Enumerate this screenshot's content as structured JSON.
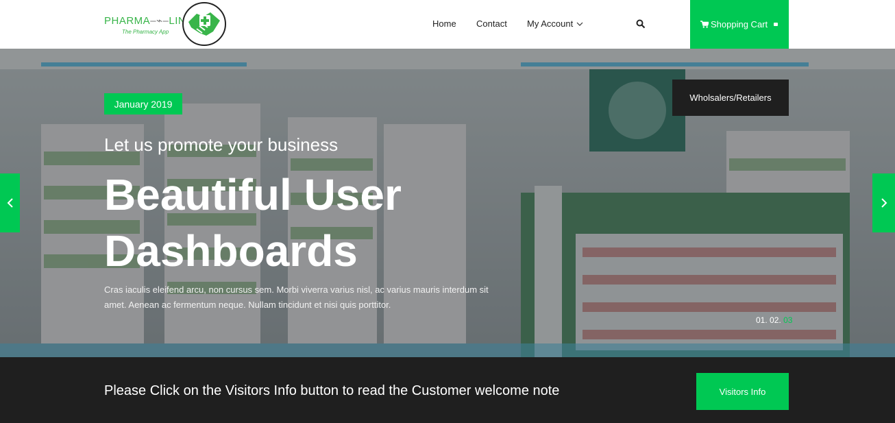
{
  "brand": {
    "name_left": "PHARMA",
    "name_right": "LINK",
    "tagline": "The Pharmacy App",
    "accent_color": "#00c853"
  },
  "nav": {
    "items": [
      {
        "label": "Home"
      },
      {
        "label": "Contact"
      },
      {
        "label": "My Account"
      }
    ],
    "search_icon": "search-icon",
    "cart_label": "Shopping Cart",
    "cart_icon": "shopping-cart-icon"
  },
  "hero": {
    "date_badge": "January 2019",
    "subtitle": "Let us promote your business",
    "title": "Beautiful User Dashboards",
    "text": "Cras iaculis eleifend arcu, non cursus sem. Morbi viverra varius nisl, ac varius mauris interdum sit amet. Aenean ac fermentum neque. Nullam tincidunt et nisi quis porttitor.",
    "cta_label": "Wholsalers/Retailers",
    "pager": [
      "01.",
      "02.",
      "03"
    ],
    "active_slide": 3
  },
  "bottom_bar": {
    "message": "Please Click on the Visitors Info button to read the Customer welcome note",
    "button_label": "Visitors Info"
  }
}
